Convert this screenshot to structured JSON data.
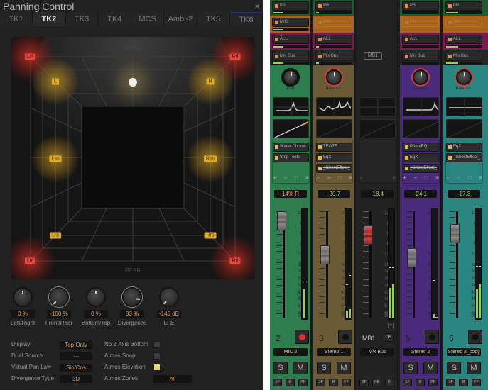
{
  "panner": {
    "title": "Panning Control",
    "close_icon": "×",
    "tabs": [
      {
        "label": "TK1"
      },
      {
        "label": "TK2",
        "active": true
      },
      {
        "label": "TK3"
      },
      {
        "label": "TK4"
      },
      {
        "label": "MCS"
      },
      {
        "label": "Ambi-2"
      },
      {
        "label": "TK5"
      },
      {
        "label": "TK6"
      }
    ],
    "field": {
      "front_label": "FRONT",
      "rear_label": "REAR",
      "speakers": {
        "ltf": "Ltf",
        "rtf": "Rtf",
        "l": "L",
        "r": "R",
        "lss": "Lss",
        "rss": "Rss",
        "lrs": "Lrs",
        "rrs": "Rrs",
        "ltr": "Ltr",
        "rtr": "Rtr"
      }
    },
    "knobs": [
      {
        "label": "Left/Right",
        "value": "0 %"
      },
      {
        "label": "Front/Rear",
        "value": "-100 %"
      },
      {
        "label": "Bottom/Top",
        "value": "0 %"
      },
      {
        "label": "Divergence",
        "value": "83 %"
      },
      {
        "label": "LFE",
        "value": "-145 dB"
      }
    ],
    "options": {
      "display": {
        "label": "Display",
        "value": "Top Only"
      },
      "dual_source": {
        "label": "Dual Source",
        "value": "---"
      },
      "virtual_pan_law": {
        "label": "Virtual Pan Law",
        "value": "Sin/Cos"
      },
      "divergence_type": {
        "label": "Divergence Type",
        "value": "3D"
      },
      "no_z_axis_bottom": {
        "label": "No Z Axis Bottom",
        "checked": false
      },
      "atmos_snap": {
        "label": "Atmos Snap",
        "checked": false
      },
      "atmos_elevation": {
        "label": "Atmos Elevation",
        "checked": true
      },
      "atmos_zones": {
        "label": "Atmos Zones",
        "value": "All"
      }
    }
  },
  "mixer": {
    "bus_tag": "MB1",
    "fader_scale": [
      "12",
      "6",
      "0",
      "6",
      "12",
      "18",
      "24",
      "30",
      "36",
      "42",
      "48",
      "54",
      "60",
      "00"
    ],
    "strips": [
      {
        "number": "2",
        "name": "MIC 2",
        "color": "#2e7d4f",
        "sends": [
          "PB",
          "MIC",
          "ALL",
          "Mix Bus"
        ],
        "knob_label": "Pan",
        "readout": "14% R",
        "fx": [
          {
            "name": "Water Chorus"
          },
          {
            "name": "Strip Tools"
          }
        ],
        "rec_armed": true,
        "solo": "S",
        "mute": "M",
        "buttons": [
          "SF",
          "Ø",
          "PF"
        ]
      },
      {
        "number": "3",
        "name": "Stereo 1",
        "color": "#6b5a36",
        "sends": [
          "PB",
          "MIC",
          "ALL",
          "Mix Bus"
        ],
        "knob_label": "Balance",
        "readout": "-20.7",
        "fx": [
          {
            "name": "TEOTE"
          },
          {
            "name": "EqX"
          },
          {
            "name": "_GhostEffect_",
            "bypassed": true
          }
        ],
        "rec_armed": false,
        "solo": "S",
        "mute": "M",
        "buttons": [
          "SF",
          "Ø",
          "PF"
        ]
      },
      {
        "number": "MB1",
        "name": "Mix Bus",
        "color": "#222222",
        "readout": "-18.4",
        "os_label": "OS",
        "buttons": [
          "SF",
          "RE",
          "DI"
        ]
      },
      {
        "number": "5",
        "name": "Stereo 2",
        "color": "#4a2a7a",
        "sends": [
          "PB",
          "MIC",
          "ALL",
          "Mix Bus"
        ],
        "knob_label": "Balance",
        "readout": "-24.1",
        "fx": [
          {
            "name": "PrimeEQ"
          },
          {
            "name": "EqX"
          },
          {
            "name": "_GhostEffect_",
            "bypassed": true
          }
        ],
        "rec_armed": false,
        "solo": "S",
        "mute": "M",
        "buttons": [
          "SF",
          "Ø",
          "PF"
        ]
      },
      {
        "number": "6",
        "name": "Stereo 2_copy",
        "color": "#2a8580",
        "sends": [
          "PB",
          "MIC",
          "ALL",
          "Mix Bus"
        ],
        "knob_label": "Balance",
        "readout": "-17.3",
        "fx": [
          {
            "name": "EqX"
          },
          {
            "name": "_GhostEffect_",
            "bypassed": true
          }
        ],
        "rec_armed": false,
        "solo": "S",
        "mute": "M",
        "buttons": [
          "SF",
          "Ø",
          "PF"
        ]
      }
    ]
  }
}
